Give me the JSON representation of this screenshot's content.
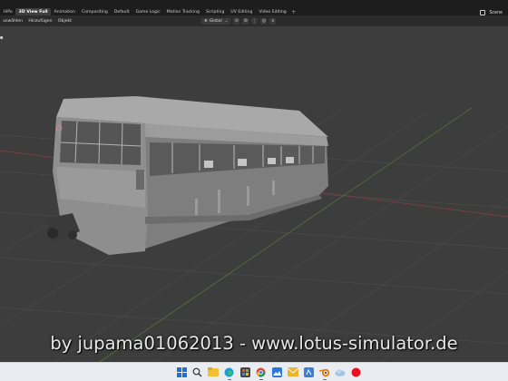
{
  "workspace_tabs": [
    {
      "label": "HiPo",
      "active": false
    },
    {
      "label": "3D View Full",
      "active": true
    },
    {
      "label": "Animation",
      "active": false
    },
    {
      "label": "Compositing",
      "active": false
    },
    {
      "label": "Default",
      "active": false
    },
    {
      "label": "Game Logic",
      "active": false
    },
    {
      "label": "Motion Tracking",
      "active": false
    },
    {
      "label": "Scripting",
      "active": false
    },
    {
      "label": "UV Editing",
      "active": false
    },
    {
      "label": "Video Editing",
      "active": false
    }
  ],
  "add_workspace_label": "+",
  "scene": {
    "label": "Scene"
  },
  "header_menu": [
    "uswählen",
    "Hinzufügen",
    "Objekt"
  ],
  "transform_orientation": "Global",
  "left_fragment": "e",
  "watermark": "by jupama01062013 - www.lotus-simulator.de",
  "taskbar_icons": [
    "windows-start",
    "search",
    "file-explorer",
    "edge",
    "chrome",
    "chrome-alt",
    "explorer-2",
    "store",
    "blender",
    "mail",
    "red-app"
  ],
  "colors": {
    "viewport_bg": "#3d3d3d",
    "topbar_bg": "#1d1d1d",
    "model_gray": "#8a8a8a",
    "taskbar_bg": "#e9ecf1"
  }
}
